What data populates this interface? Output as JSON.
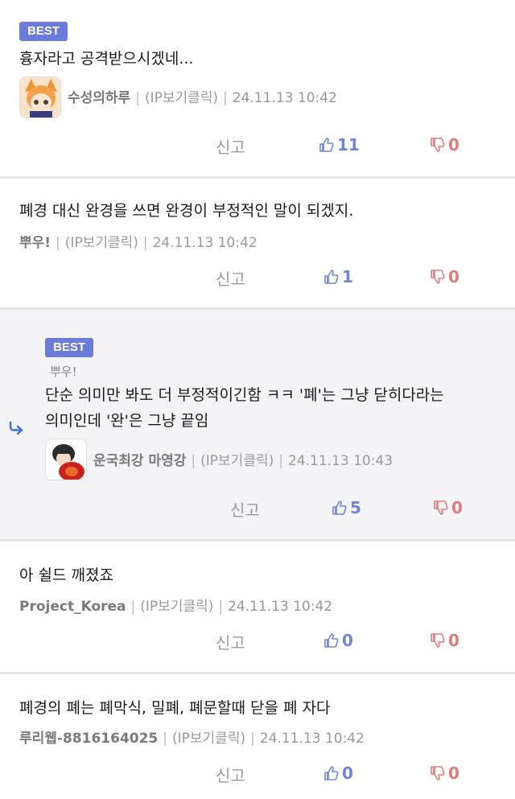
{
  "labels": {
    "best": "BEST",
    "report": "신고",
    "ip": "(IP보기클릭)",
    "sep": "|"
  },
  "comments": [
    {
      "text": "흉자라고 공격받으시겠네...",
      "nick": "수성의하루",
      "date": "24.11.13 10:42",
      "likes": "11",
      "dislikes": "0"
    },
    {
      "text": "폐경 대신 완경을 쓰면 완경이 부정적인 말이 되겠지.",
      "nick": "뿌우!",
      "date": "24.11.13 10:42",
      "likes": "1",
      "dislikes": "0"
    },
    {
      "reply_to": "뿌우!",
      "text_line1": "단순 의미만 봐도 더 부정적이긴함 ㅋㅋ  '폐'는 그냥 닫히다라는",
      "text_line2": "의미인데  '완'은 그냥 끝임",
      "nick": "운국최강 마영강",
      "date": "24.11.13 10:43",
      "likes": "5",
      "dislikes": "0"
    },
    {
      "text": "아 쉴드 깨졌죠",
      "nick": "Project_Korea",
      "date": "24.11.13 10:42",
      "likes": "0",
      "dislikes": "0"
    },
    {
      "text": "폐경의 폐는 폐막식, 밀폐, 폐문할때 닫을 폐 자다",
      "nick": "루리웹-8816164025",
      "date": "24.11.13 10:42",
      "likes": "0",
      "dislikes": "0"
    }
  ],
  "colors": {
    "best": "#6b7bd8",
    "like": "#6c85d8",
    "dislike": "#e07b7b"
  }
}
